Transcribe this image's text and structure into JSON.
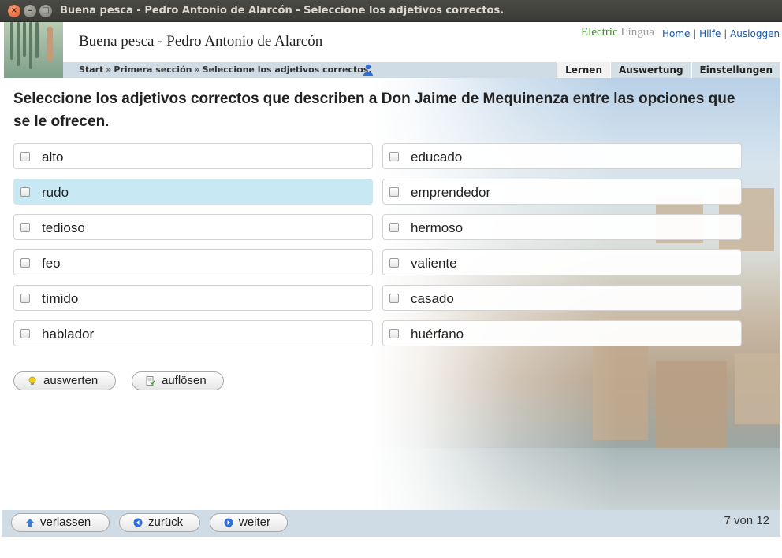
{
  "window": {
    "title": "Buena pesca - Pedro Antonio de Alarcón - Seleccione los adjetivos correctos."
  },
  "header": {
    "book_title": "Buena pesca - Pedro Antonio de Alarcón",
    "brand_part1": "Electric",
    "brand_part2": "Lingua",
    "links": [
      "Home",
      "Hilfe",
      "Ausloggen"
    ]
  },
  "breadcrumb": [
    "Start",
    "Primera sección",
    "Seleccione los adjetivos correctos."
  ],
  "tabs": [
    {
      "label": "Lernen",
      "active": true
    },
    {
      "label": "Auswertung",
      "active": false
    },
    {
      "label": "Einstellungen",
      "active": false
    }
  ],
  "question": "Seleccione los adjetivos correctos que describen a Don Jaime de Mequinenza entre las opciones que se le ofrecen.",
  "options_left": [
    "alto",
    "rudo",
    "tedioso",
    "feo",
    "tímido",
    "hablador"
  ],
  "options_right": [
    "educado",
    "emprendedor",
    "hermoso",
    "valiente",
    "casado",
    "huérfano"
  ],
  "highlighted_option": "rudo",
  "actions": {
    "evaluate": "auswerten",
    "solve": "auflösen"
  },
  "footer": {
    "leave": "verlassen",
    "back": "zurück",
    "next": "weiter",
    "counter": "7 von 12"
  },
  "colors": {
    "accent_bar": "#cfdce6",
    "highlight": "#c8e9f3",
    "link": "#1d55a8",
    "brand_green": "#3c8a2a"
  }
}
